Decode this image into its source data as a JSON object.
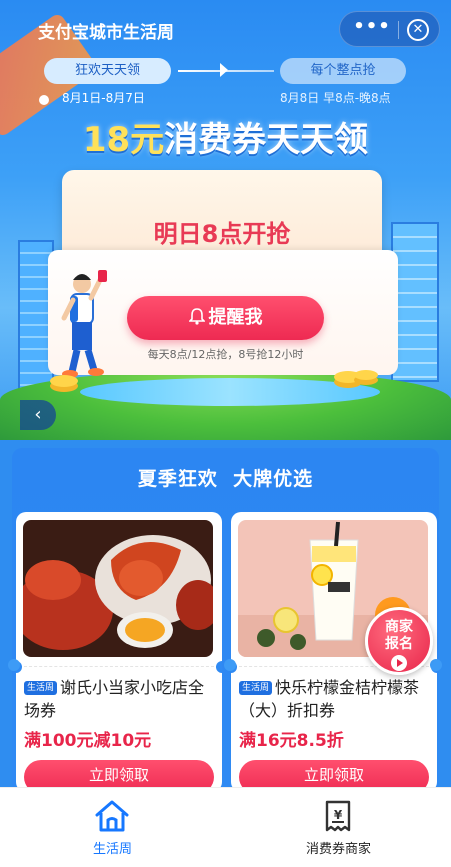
{
  "header": {
    "app_title": "支付宝城市生活周",
    "more_label": "•••",
    "close_label": "✕"
  },
  "stages": [
    {
      "label": "狂欢天天领",
      "date": "8月1日-8月7日"
    },
    {
      "label": "每个整点抢",
      "date": "8月8日 早8点-晚8点"
    }
  ],
  "hero": {
    "title_amount": "18元",
    "title_rest": "消费券天天领",
    "countdown_message": "明日8点开抢",
    "remind_button": "提醒我",
    "remind_note": "每天8点/12点抢，8号抢12小时"
  },
  "promo": {
    "section_title": "夏季狂欢  大牌优选",
    "merchant_badge": [
      "商家",
      "报名"
    ],
    "cards": [
      {
        "tag": "生活周",
        "name": "谢氏小当家小吃店全场券",
        "price": "满100元减10元",
        "button": "立即领取"
      },
      {
        "tag": "生活周",
        "name": "快乐柠檬金桔柠檬茶（大）折扣券",
        "price": "满16元8.5折",
        "button": "立即领取"
      }
    ]
  },
  "tabbar": {
    "tabs": [
      {
        "label": "生活周",
        "icon": "home-icon",
        "active": true
      },
      {
        "label": "消费券商家",
        "icon": "coupon-receipt-icon",
        "active": false
      }
    ]
  },
  "colors": {
    "primary_blue": "#1677ff",
    "accent_red": "#e8254a",
    "title_yellow": "#ffe15a"
  }
}
